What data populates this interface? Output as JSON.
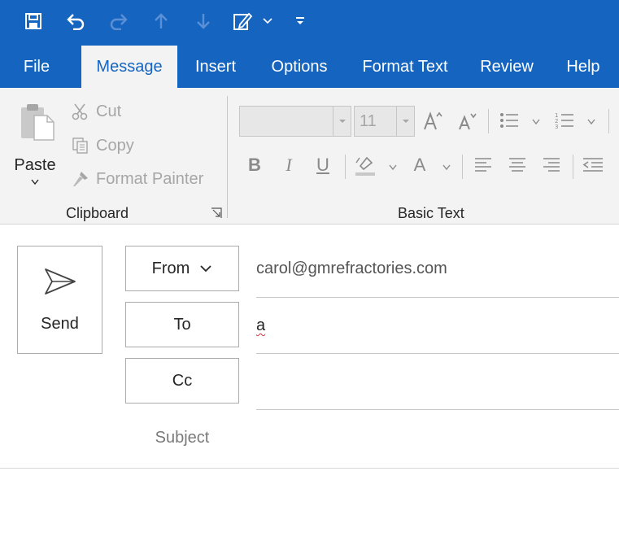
{
  "qat": {
    "icons": [
      "save-icon",
      "undo-icon",
      "redo-icon",
      "up-arrow-icon",
      "down-arrow-icon",
      "draft-icon",
      "customize-icon"
    ]
  },
  "tabs": [
    {
      "label": "File"
    },
    {
      "label": "Message",
      "active": true
    },
    {
      "label": "Insert"
    },
    {
      "label": "Options"
    },
    {
      "label": "Format Text"
    },
    {
      "label": "Review"
    },
    {
      "label": "Help"
    }
  ],
  "clipboard": {
    "paste_label": "Paste",
    "cut_label": "Cut",
    "copy_label": "Copy",
    "format_painter_label": "Format Painter",
    "group_label": "Clipboard"
  },
  "basic_text": {
    "font_name": "",
    "font_size": "11",
    "group_label": "Basic Text",
    "bold": "B",
    "italic": "I",
    "underline": "U",
    "font_color": "A"
  },
  "compose": {
    "send_label": "Send",
    "from_label": "From",
    "from_value": "carol@gmrefractories.com",
    "to_label": "To",
    "to_value": "a",
    "cc_label": "Cc",
    "cc_value": "",
    "subject_label": "Subject"
  },
  "colors": {
    "accent": "#1565c0",
    "ribbon": "#f3f3f3",
    "disabled": "#a6a6a6"
  }
}
